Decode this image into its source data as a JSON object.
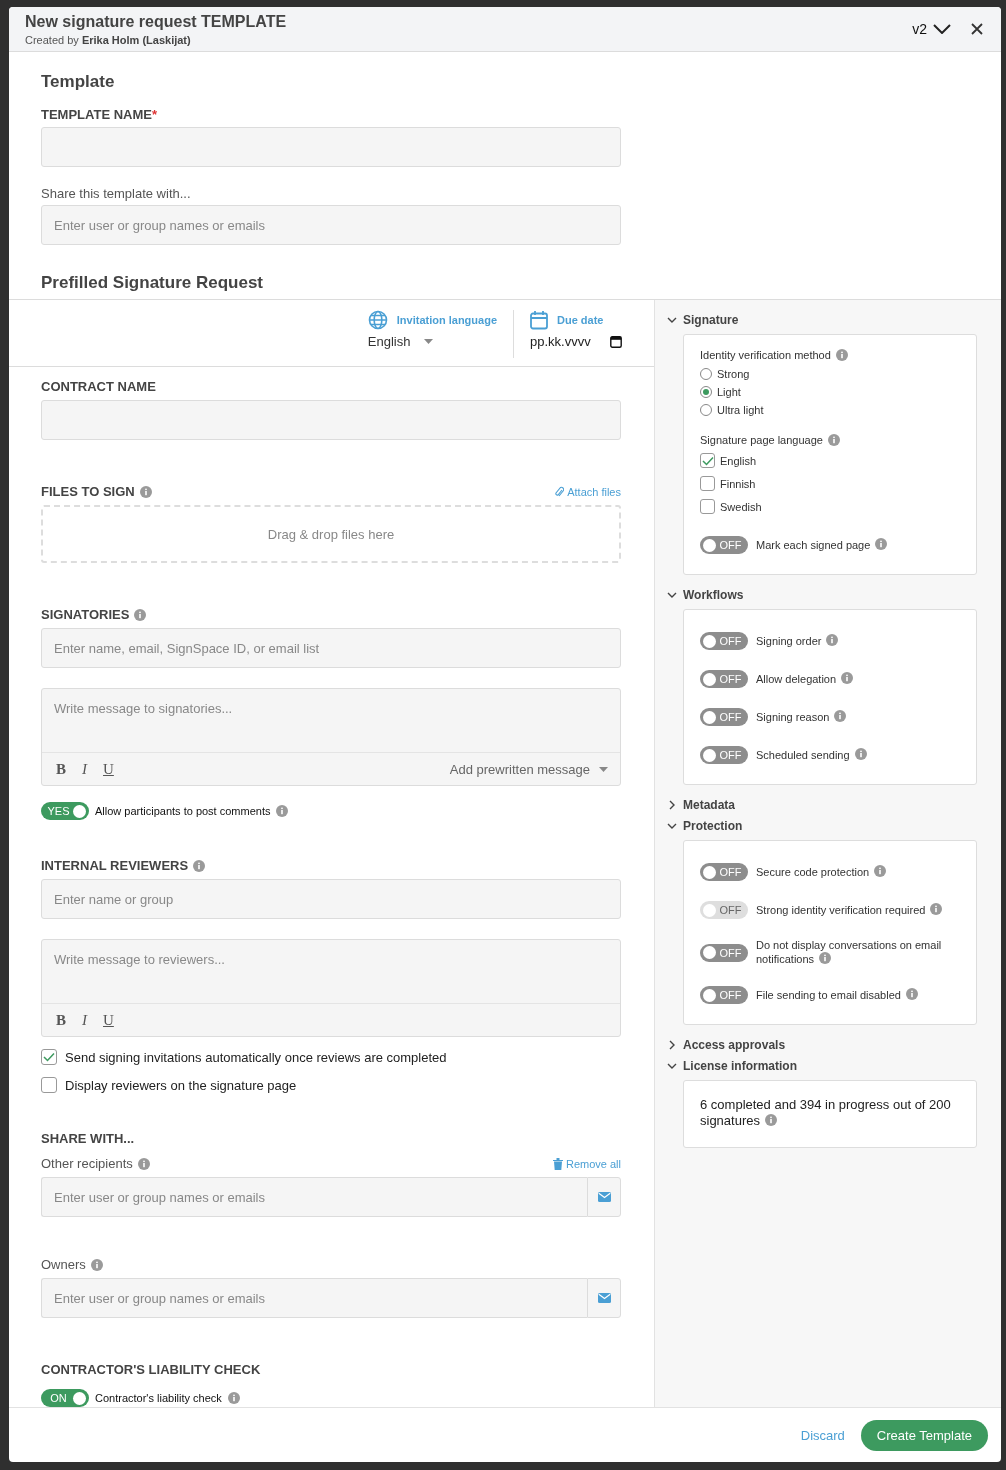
{
  "header": {
    "title": "New signature request TEMPLATE",
    "subtitle": "Created by **Erika Holm (Laskijat)**",
    "version": "v2"
  },
  "template": {
    "heading": "Template",
    "name_label": "TEMPLATE NAME",
    "required_mark": "*",
    "share_label": "Share this template with...",
    "share_placeholder": "Enter user or group names or emails"
  },
  "prefilled": {
    "heading": "Prefilled Signature Request",
    "invitation_language": {
      "label": "Invitation language",
      "value": "English"
    },
    "due_date": {
      "label": "Due date",
      "placeholder": "pp.kk.vvvv"
    },
    "contract": {
      "label": "CONTRACT NAME"
    },
    "files": {
      "label": "FILES TO SIGN",
      "attach": "Attach files",
      "drop": "Drag & drop files here"
    },
    "signatories": {
      "label": "SIGNATORIES",
      "placeholder": "Enter name, email, SignSpace ID, or email list",
      "message_placeholder": "Write message to signatories...",
      "format_buttons": [
        "B",
        "I",
        "U"
      ],
      "prewritten": "Add prewritten message",
      "toggle": {
        "on": true,
        "text": "YES",
        "label": "Allow participants to post comments"
      }
    },
    "reviewers": {
      "label": "INTERNAL REVIEWERS",
      "placeholder": "Enter name or group",
      "message_placeholder": "Write message to reviewers...",
      "format_buttons": [
        "B",
        "I",
        "U"
      ],
      "options": [
        {
          "label": "Send signing invitations automatically once reviews are completed",
          "checked": true
        },
        {
          "label": "Display reviewers on the signature page",
          "checked": false
        }
      ]
    },
    "share": {
      "heading": "SHARE WITH...",
      "groups": [
        {
          "label": "Other recipients",
          "action": "Remove all",
          "placeholder": "Enter user or group names or emails"
        },
        {
          "label": "Owners",
          "placeholder": "Enter user or group names or emails"
        }
      ]
    },
    "liability": {
      "heading": "CONTRACTOR'S LIABILITY CHECK",
      "toggle": {
        "on": true,
        "text": "ON",
        "label": "Contractor's liability check"
      }
    }
  },
  "panel": [
    {
      "title": "Signature",
      "expanded": true,
      "items": [
        {
          "kind": "heading",
          "label": "Identity verification method"
        },
        {
          "kind": "radio",
          "label": "Strong",
          "selected": false
        },
        {
          "kind": "radio",
          "label": "Light",
          "selected": true
        },
        {
          "kind": "radio",
          "label": "Ultra light",
          "selected": false
        },
        {
          "kind": "heading",
          "label": "Signature page language"
        },
        {
          "kind": "checkbox",
          "label": "English",
          "checked": true
        },
        {
          "kind": "checkbox",
          "label": "Finnish",
          "checked": false
        },
        {
          "kind": "checkbox",
          "label": "Swedish",
          "checked": false
        },
        {
          "kind": "toggle",
          "label": "Mark each signed page",
          "text": "OFF",
          "on": false,
          "disabled": false
        }
      ]
    },
    {
      "title": "Workflows",
      "expanded": true,
      "items": [
        {
          "kind": "toggle",
          "label": "Signing order",
          "text": "OFF",
          "on": false,
          "disabled": false
        },
        {
          "kind": "toggle",
          "label": "Allow delegation",
          "text": "OFF",
          "on": false,
          "disabled": false
        },
        {
          "kind": "toggle",
          "label": "Signing reason",
          "text": "OFF",
          "on": false,
          "disabled": false
        },
        {
          "kind": "toggle",
          "label": "Scheduled sending",
          "text": "OFF",
          "on": false,
          "disabled": false
        }
      ]
    },
    {
      "title": "Metadata",
      "expanded": false
    },
    {
      "title": "Protection",
      "expanded": true,
      "items": [
        {
          "kind": "toggle",
          "label": "Secure code protection",
          "text": "OFF",
          "on": false,
          "disabled": false
        },
        {
          "kind": "toggle",
          "label": "Strong identity verification required",
          "text": "OFF",
          "on": false,
          "disabled": true
        },
        {
          "kind": "toggle",
          "label": "Do not display conversations on email notifications",
          "text": "OFF",
          "on": false,
          "disabled": false
        },
        {
          "kind": "toggle",
          "label": "File sending to email disabled",
          "text": "OFF",
          "on": false,
          "disabled": false
        }
      ]
    },
    {
      "title": "Access approvals",
      "expanded": false
    },
    {
      "title": "License information",
      "expanded": true,
      "items": [
        {
          "kind": "text",
          "label": "6 completed and 394 in progress out of 200 signatures"
        }
      ]
    }
  ],
  "footer": {
    "discard": "Discard",
    "create": "Create Template"
  }
}
